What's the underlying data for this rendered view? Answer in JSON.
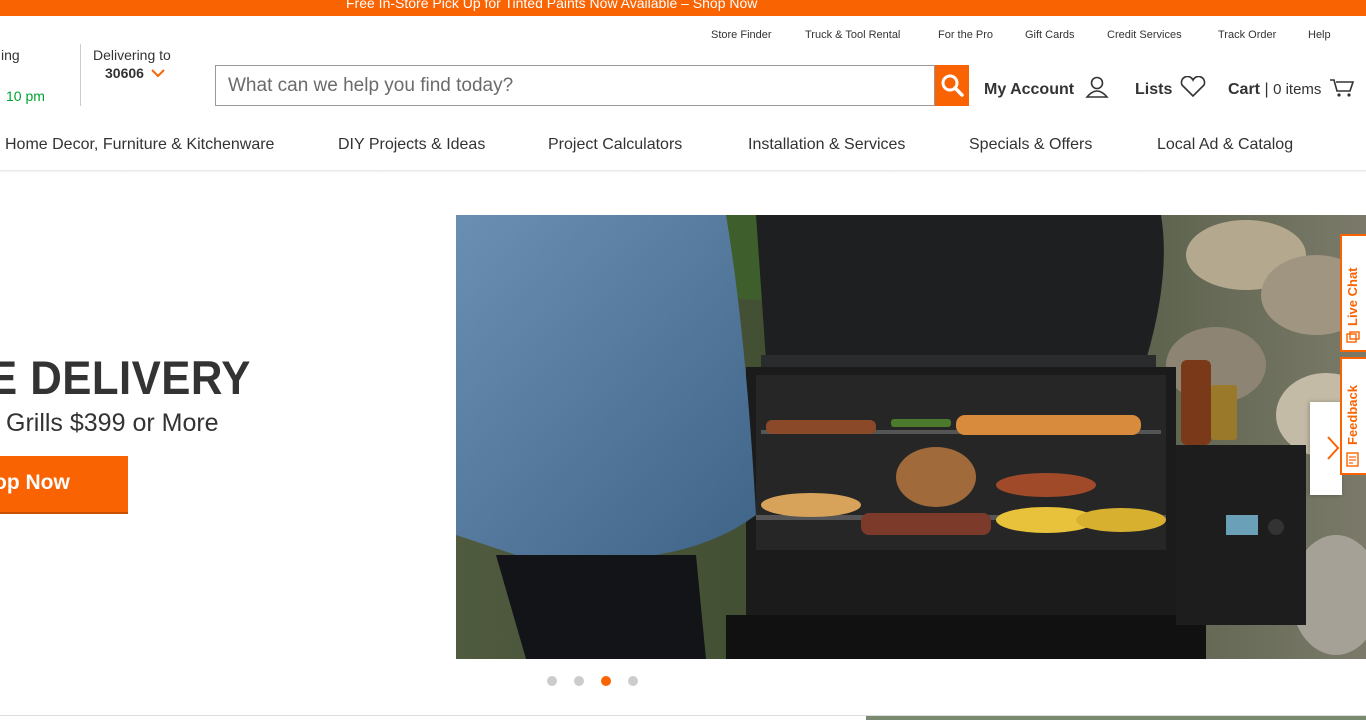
{
  "promo": {
    "text": "Free In-Store Pick Up for Tinted Paints Now Available – Shop Now"
  },
  "utility_links": [
    "Store Finder",
    "Truck & Tool Rental",
    "For the Pro",
    "Gift Cards",
    "Credit Services",
    "Track Order",
    "Help"
  ],
  "store": {
    "status_fragment": "ing",
    "hours_fragment": "10 pm"
  },
  "delivery": {
    "label": "Delivering to",
    "zip": "30606"
  },
  "search": {
    "placeholder": "What can we help you find today?"
  },
  "account": {
    "my_account": "My Account",
    "lists": "Lists",
    "cart_label": "Cart",
    "cart_count": "0 items"
  },
  "nav": [
    "Home Decor, Furniture & Kitchenware",
    "DIY Projects & Ideas",
    "Project Calculators",
    "Installation & Services",
    "Specials & Offers",
    "Local Ad & Catalog"
  ],
  "hero": {
    "title": "E DELIVERY",
    "subtitle": "Grills $399 or More",
    "cta": "op Now",
    "carousel_total": 4,
    "carousel_active": 3
  },
  "side_tabs": {
    "live_chat": "Live Chat",
    "feedback": "Feedback"
  },
  "colors": {
    "brand_orange": "#f96302",
    "text": "#333333",
    "store_green": "#00a330"
  },
  "icons": [
    "search-icon",
    "chevron-down-icon",
    "user-icon",
    "heart-icon",
    "cart-icon",
    "chevron-right-icon",
    "chat-icon",
    "feedback-icon"
  ]
}
